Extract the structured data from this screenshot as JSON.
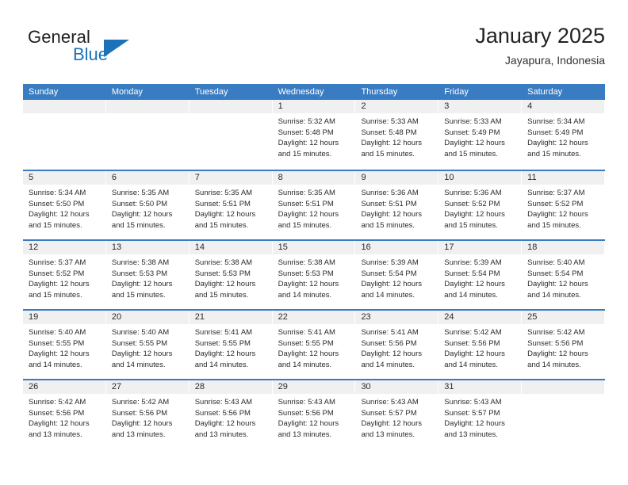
{
  "brand": {
    "line1": "General",
    "line2": "Blue",
    "triangle_icon": "triangle-logo-icon",
    "color_dark": "#231f20",
    "color_blue": "#1b72b8"
  },
  "header": {
    "title": "January 2025",
    "subtitle": "Jayapura, Indonesia"
  },
  "theme": {
    "header_blue": "#3a7cc1",
    "daynum_band": "#f0f0f0",
    "text": "#2b2b2b"
  },
  "calendar": {
    "weekday_headers": [
      "Sunday",
      "Monday",
      "Tuesday",
      "Wednesday",
      "Thursday",
      "Friday",
      "Saturday"
    ],
    "weeks": [
      [
        {
          "day": "",
          "empty": true
        },
        {
          "day": "",
          "empty": true
        },
        {
          "day": "",
          "empty": true
        },
        {
          "day": "1",
          "sunrise": "Sunrise: 5:32 AM",
          "sunset": "Sunset: 5:48 PM",
          "daylight_1": "Daylight: 12 hours",
          "daylight_2": "and 15 minutes."
        },
        {
          "day": "2",
          "sunrise": "Sunrise: 5:33 AM",
          "sunset": "Sunset: 5:48 PM",
          "daylight_1": "Daylight: 12 hours",
          "daylight_2": "and 15 minutes."
        },
        {
          "day": "3",
          "sunrise": "Sunrise: 5:33 AM",
          "sunset": "Sunset: 5:49 PM",
          "daylight_1": "Daylight: 12 hours",
          "daylight_2": "and 15 minutes."
        },
        {
          "day": "4",
          "sunrise": "Sunrise: 5:34 AM",
          "sunset": "Sunset: 5:49 PM",
          "daylight_1": "Daylight: 12 hours",
          "daylight_2": "and 15 minutes."
        }
      ],
      [
        {
          "day": "5",
          "sunrise": "Sunrise: 5:34 AM",
          "sunset": "Sunset: 5:50 PM",
          "daylight_1": "Daylight: 12 hours",
          "daylight_2": "and 15 minutes."
        },
        {
          "day": "6",
          "sunrise": "Sunrise: 5:35 AM",
          "sunset": "Sunset: 5:50 PM",
          "daylight_1": "Daylight: 12 hours",
          "daylight_2": "and 15 minutes."
        },
        {
          "day": "7",
          "sunrise": "Sunrise: 5:35 AM",
          "sunset": "Sunset: 5:51 PM",
          "daylight_1": "Daylight: 12 hours",
          "daylight_2": "and 15 minutes."
        },
        {
          "day": "8",
          "sunrise": "Sunrise: 5:35 AM",
          "sunset": "Sunset: 5:51 PM",
          "daylight_1": "Daylight: 12 hours",
          "daylight_2": "and 15 minutes."
        },
        {
          "day": "9",
          "sunrise": "Sunrise: 5:36 AM",
          "sunset": "Sunset: 5:51 PM",
          "daylight_1": "Daylight: 12 hours",
          "daylight_2": "and 15 minutes."
        },
        {
          "day": "10",
          "sunrise": "Sunrise: 5:36 AM",
          "sunset": "Sunset: 5:52 PM",
          "daylight_1": "Daylight: 12 hours",
          "daylight_2": "and 15 minutes."
        },
        {
          "day": "11",
          "sunrise": "Sunrise: 5:37 AM",
          "sunset": "Sunset: 5:52 PM",
          "daylight_1": "Daylight: 12 hours",
          "daylight_2": "and 15 minutes."
        }
      ],
      [
        {
          "day": "12",
          "sunrise": "Sunrise: 5:37 AM",
          "sunset": "Sunset: 5:52 PM",
          "daylight_1": "Daylight: 12 hours",
          "daylight_2": "and 15 minutes."
        },
        {
          "day": "13",
          "sunrise": "Sunrise: 5:38 AM",
          "sunset": "Sunset: 5:53 PM",
          "daylight_1": "Daylight: 12 hours",
          "daylight_2": "and 15 minutes."
        },
        {
          "day": "14",
          "sunrise": "Sunrise: 5:38 AM",
          "sunset": "Sunset: 5:53 PM",
          "daylight_1": "Daylight: 12 hours",
          "daylight_2": "and 15 minutes."
        },
        {
          "day": "15",
          "sunrise": "Sunrise: 5:38 AM",
          "sunset": "Sunset: 5:53 PM",
          "daylight_1": "Daylight: 12 hours",
          "daylight_2": "and 14 minutes."
        },
        {
          "day": "16",
          "sunrise": "Sunrise: 5:39 AM",
          "sunset": "Sunset: 5:54 PM",
          "daylight_1": "Daylight: 12 hours",
          "daylight_2": "and 14 minutes."
        },
        {
          "day": "17",
          "sunrise": "Sunrise: 5:39 AM",
          "sunset": "Sunset: 5:54 PM",
          "daylight_1": "Daylight: 12 hours",
          "daylight_2": "and 14 minutes."
        },
        {
          "day": "18",
          "sunrise": "Sunrise: 5:40 AM",
          "sunset": "Sunset: 5:54 PM",
          "daylight_1": "Daylight: 12 hours",
          "daylight_2": "and 14 minutes."
        }
      ],
      [
        {
          "day": "19",
          "sunrise": "Sunrise: 5:40 AM",
          "sunset": "Sunset: 5:55 PM",
          "daylight_1": "Daylight: 12 hours",
          "daylight_2": "and 14 minutes."
        },
        {
          "day": "20",
          "sunrise": "Sunrise: 5:40 AM",
          "sunset": "Sunset: 5:55 PM",
          "daylight_1": "Daylight: 12 hours",
          "daylight_2": "and 14 minutes."
        },
        {
          "day": "21",
          "sunrise": "Sunrise: 5:41 AM",
          "sunset": "Sunset: 5:55 PM",
          "daylight_1": "Daylight: 12 hours",
          "daylight_2": "and 14 minutes."
        },
        {
          "day": "22",
          "sunrise": "Sunrise: 5:41 AM",
          "sunset": "Sunset: 5:55 PM",
          "daylight_1": "Daylight: 12 hours",
          "daylight_2": "and 14 minutes."
        },
        {
          "day": "23",
          "sunrise": "Sunrise: 5:41 AM",
          "sunset": "Sunset: 5:56 PM",
          "daylight_1": "Daylight: 12 hours",
          "daylight_2": "and 14 minutes."
        },
        {
          "day": "24",
          "sunrise": "Sunrise: 5:42 AM",
          "sunset": "Sunset: 5:56 PM",
          "daylight_1": "Daylight: 12 hours",
          "daylight_2": "and 14 minutes."
        },
        {
          "day": "25",
          "sunrise": "Sunrise: 5:42 AM",
          "sunset": "Sunset: 5:56 PM",
          "daylight_1": "Daylight: 12 hours",
          "daylight_2": "and 14 minutes."
        }
      ],
      [
        {
          "day": "26",
          "sunrise": "Sunrise: 5:42 AM",
          "sunset": "Sunset: 5:56 PM",
          "daylight_1": "Daylight: 12 hours",
          "daylight_2": "and 13 minutes."
        },
        {
          "day": "27",
          "sunrise": "Sunrise: 5:42 AM",
          "sunset": "Sunset: 5:56 PM",
          "daylight_1": "Daylight: 12 hours",
          "daylight_2": "and 13 minutes."
        },
        {
          "day": "28",
          "sunrise": "Sunrise: 5:43 AM",
          "sunset": "Sunset: 5:56 PM",
          "daylight_1": "Daylight: 12 hours",
          "daylight_2": "and 13 minutes."
        },
        {
          "day": "29",
          "sunrise": "Sunrise: 5:43 AM",
          "sunset": "Sunset: 5:56 PM",
          "daylight_1": "Daylight: 12 hours",
          "daylight_2": "and 13 minutes."
        },
        {
          "day": "30",
          "sunrise": "Sunrise: 5:43 AM",
          "sunset": "Sunset: 5:57 PM",
          "daylight_1": "Daylight: 12 hours",
          "daylight_2": "and 13 minutes."
        },
        {
          "day": "31",
          "sunrise": "Sunrise: 5:43 AM",
          "sunset": "Sunset: 5:57 PM",
          "daylight_1": "Daylight: 12 hours",
          "daylight_2": "and 13 minutes."
        },
        {
          "day": "",
          "empty": true
        }
      ]
    ]
  }
}
